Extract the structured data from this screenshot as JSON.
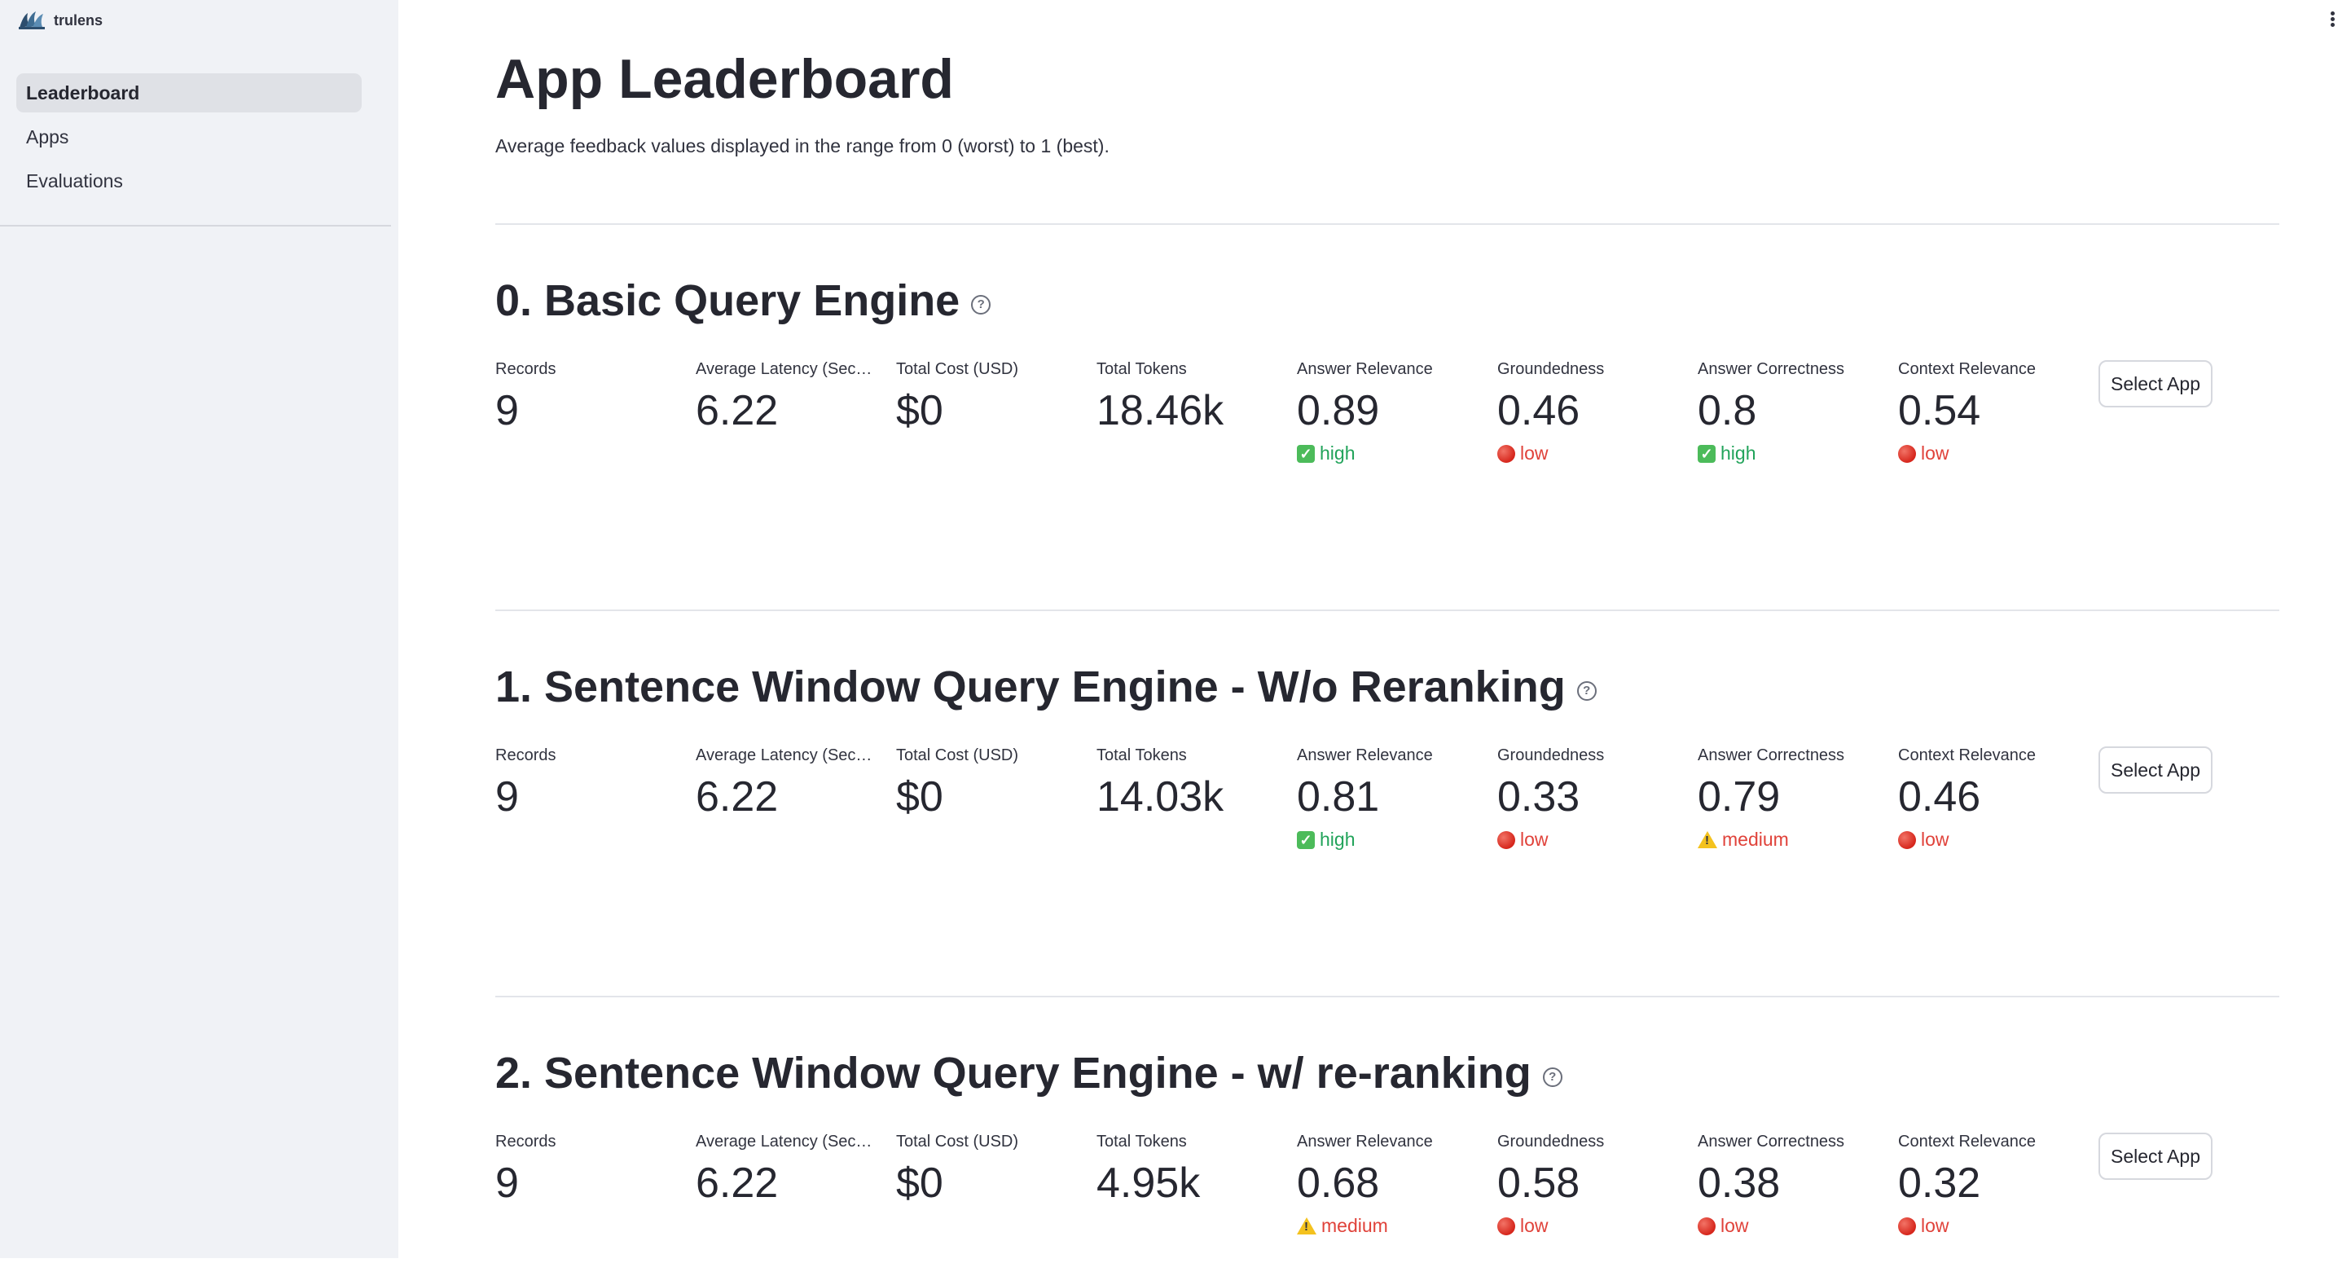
{
  "app": {
    "logo_text": "trulens"
  },
  "sidebar": {
    "items": [
      {
        "label": "Leaderboard",
        "active": true
      },
      {
        "label": "Apps"
      },
      {
        "label": "Evaluations"
      }
    ]
  },
  "main": {
    "title": "App Leaderboard",
    "caption": "Average feedback values displayed in the range from 0 (worst) to 1 (best).",
    "metric_labels": [
      "Records",
      "Average Latency (Seco…",
      "Total Cost (USD)",
      "Total Tokens",
      "Answer Relevance",
      "Groundedness",
      "Answer Correctness",
      "Context Relevance"
    ],
    "select_label": "Select App",
    "apps": [
      {
        "title": "0. Basic Query Engine",
        "values": [
          "9",
          "6.22",
          "$0",
          "18.46k",
          "0.89",
          "0.46",
          "0.8",
          "0.54"
        ],
        "deltas": [
          null,
          null,
          null,
          null,
          "high",
          "low",
          "high",
          "low"
        ]
      },
      {
        "title": "1. Sentence Window Query Engine - W/o Reranking",
        "values": [
          "9",
          "6.22",
          "$0",
          "14.03k",
          "0.81",
          "0.33",
          "0.79",
          "0.46"
        ],
        "deltas": [
          null,
          null,
          null,
          null,
          "high",
          "low",
          "medium",
          "low"
        ]
      },
      {
        "title": "2. Sentence Window Query Engine - w/ re-ranking",
        "values": [
          "9",
          "6.22",
          "$0",
          "4.95k",
          "0.68",
          "0.58",
          "0.38",
          "0.32"
        ],
        "deltas": [
          null,
          null,
          null,
          null,
          "medium",
          "low",
          "low",
          "low"
        ]
      }
    ]
  },
  "colors": {
    "high": "#21a35a",
    "low": "#e0423a",
    "medium": "#e0423a",
    "sidebar_bg": "#f0f2f6"
  },
  "icons": {
    "high": "check-icon",
    "low": "red-circle-icon",
    "medium": "warning-icon"
  }
}
